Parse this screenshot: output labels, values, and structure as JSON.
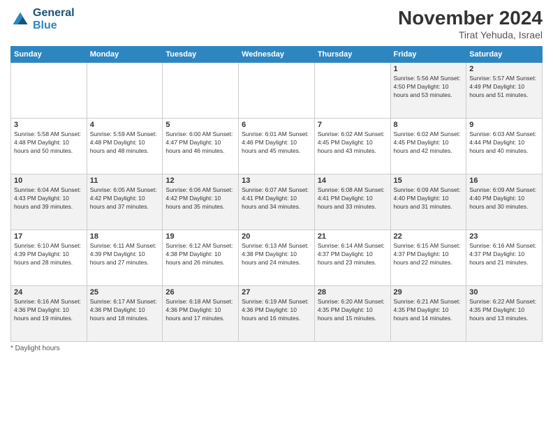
{
  "header": {
    "logo_line1": "General",
    "logo_line2": "Blue",
    "month_title": "November 2024",
    "location": "Tirat Yehuda, Israel"
  },
  "weekdays": [
    "Sunday",
    "Monday",
    "Tuesday",
    "Wednesday",
    "Thursday",
    "Friday",
    "Saturday"
  ],
  "footer": {
    "note": "Daylight hours"
  },
  "weeks": [
    {
      "days": [
        {
          "num": "",
          "info": ""
        },
        {
          "num": "",
          "info": ""
        },
        {
          "num": "",
          "info": ""
        },
        {
          "num": "",
          "info": ""
        },
        {
          "num": "",
          "info": ""
        },
        {
          "num": "1",
          "info": "Sunrise: 5:56 AM\nSunset: 4:50 PM\nDaylight: 10 hours\nand 53 minutes."
        },
        {
          "num": "2",
          "info": "Sunrise: 5:57 AM\nSunset: 4:49 PM\nDaylight: 10 hours\nand 51 minutes."
        }
      ]
    },
    {
      "days": [
        {
          "num": "3",
          "info": "Sunrise: 5:58 AM\nSunset: 4:48 PM\nDaylight: 10 hours\nand 50 minutes."
        },
        {
          "num": "4",
          "info": "Sunrise: 5:59 AM\nSunset: 4:48 PM\nDaylight: 10 hours\nand 48 minutes."
        },
        {
          "num": "5",
          "info": "Sunrise: 6:00 AM\nSunset: 4:47 PM\nDaylight: 10 hours\nand 46 minutes."
        },
        {
          "num": "6",
          "info": "Sunrise: 6:01 AM\nSunset: 4:46 PM\nDaylight: 10 hours\nand 45 minutes."
        },
        {
          "num": "7",
          "info": "Sunrise: 6:02 AM\nSunset: 4:45 PM\nDaylight: 10 hours\nand 43 minutes."
        },
        {
          "num": "8",
          "info": "Sunrise: 6:02 AM\nSunset: 4:45 PM\nDaylight: 10 hours\nand 42 minutes."
        },
        {
          "num": "9",
          "info": "Sunrise: 6:03 AM\nSunset: 4:44 PM\nDaylight: 10 hours\nand 40 minutes."
        }
      ]
    },
    {
      "days": [
        {
          "num": "10",
          "info": "Sunrise: 6:04 AM\nSunset: 4:43 PM\nDaylight: 10 hours\nand 39 minutes."
        },
        {
          "num": "11",
          "info": "Sunrise: 6:05 AM\nSunset: 4:42 PM\nDaylight: 10 hours\nand 37 minutes."
        },
        {
          "num": "12",
          "info": "Sunrise: 6:06 AM\nSunset: 4:42 PM\nDaylight: 10 hours\nand 35 minutes."
        },
        {
          "num": "13",
          "info": "Sunrise: 6:07 AM\nSunset: 4:41 PM\nDaylight: 10 hours\nand 34 minutes."
        },
        {
          "num": "14",
          "info": "Sunrise: 6:08 AM\nSunset: 4:41 PM\nDaylight: 10 hours\nand 33 minutes."
        },
        {
          "num": "15",
          "info": "Sunrise: 6:09 AM\nSunset: 4:40 PM\nDaylight: 10 hours\nand 31 minutes."
        },
        {
          "num": "16",
          "info": "Sunrise: 6:09 AM\nSunset: 4:40 PM\nDaylight: 10 hours\nand 30 minutes."
        }
      ]
    },
    {
      "days": [
        {
          "num": "17",
          "info": "Sunrise: 6:10 AM\nSunset: 4:39 PM\nDaylight: 10 hours\nand 28 minutes."
        },
        {
          "num": "18",
          "info": "Sunrise: 6:11 AM\nSunset: 4:39 PM\nDaylight: 10 hours\nand 27 minutes."
        },
        {
          "num": "19",
          "info": "Sunrise: 6:12 AM\nSunset: 4:38 PM\nDaylight: 10 hours\nand 26 minutes."
        },
        {
          "num": "20",
          "info": "Sunrise: 6:13 AM\nSunset: 4:38 PM\nDaylight: 10 hours\nand 24 minutes."
        },
        {
          "num": "21",
          "info": "Sunrise: 6:14 AM\nSunset: 4:37 PM\nDaylight: 10 hours\nand 23 minutes."
        },
        {
          "num": "22",
          "info": "Sunrise: 6:15 AM\nSunset: 4:37 PM\nDaylight: 10 hours\nand 22 minutes."
        },
        {
          "num": "23",
          "info": "Sunrise: 6:16 AM\nSunset: 4:37 PM\nDaylight: 10 hours\nand 21 minutes."
        }
      ]
    },
    {
      "days": [
        {
          "num": "24",
          "info": "Sunrise: 6:16 AM\nSunset: 4:36 PM\nDaylight: 10 hours\nand 19 minutes."
        },
        {
          "num": "25",
          "info": "Sunrise: 6:17 AM\nSunset: 4:36 PM\nDaylight: 10 hours\nand 18 minutes."
        },
        {
          "num": "26",
          "info": "Sunrise: 6:18 AM\nSunset: 4:36 PM\nDaylight: 10 hours\nand 17 minutes."
        },
        {
          "num": "27",
          "info": "Sunrise: 6:19 AM\nSunset: 4:36 PM\nDaylight: 10 hours\nand 16 minutes."
        },
        {
          "num": "28",
          "info": "Sunrise: 6:20 AM\nSunset: 4:35 PM\nDaylight: 10 hours\nand 15 minutes."
        },
        {
          "num": "29",
          "info": "Sunrise: 6:21 AM\nSunset: 4:35 PM\nDaylight: 10 hours\nand 14 minutes."
        },
        {
          "num": "30",
          "info": "Sunrise: 6:22 AM\nSunset: 4:35 PM\nDaylight: 10 hours\nand 13 minutes."
        }
      ]
    }
  ]
}
